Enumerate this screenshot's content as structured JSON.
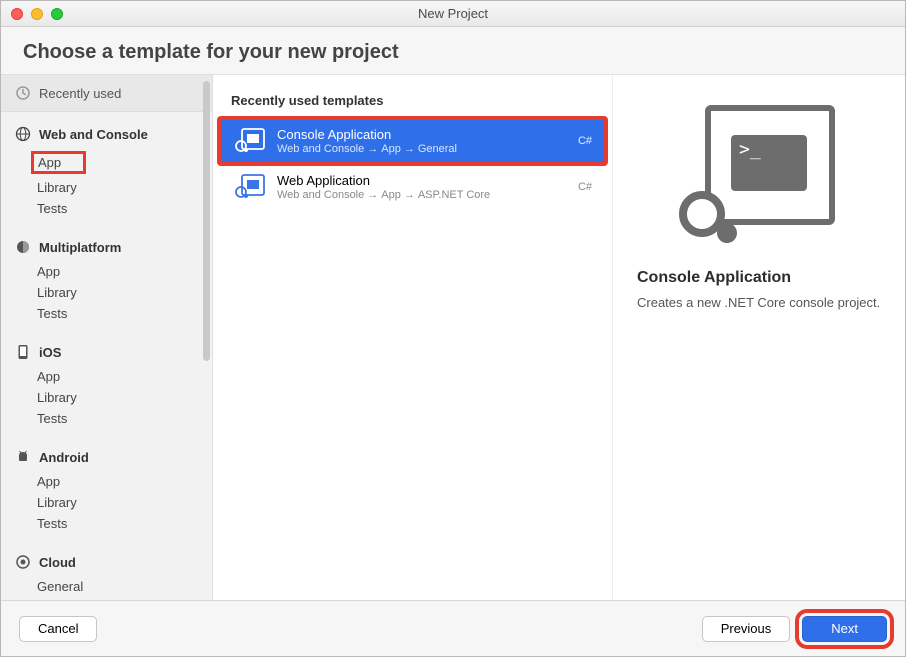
{
  "window": {
    "title": "New Project"
  },
  "header": {
    "title": "Choose a template for your new project"
  },
  "sidebar": {
    "recent_label": "Recently used",
    "categories": [
      {
        "label": "Web and Console",
        "items": [
          "App",
          "Library",
          "Tests"
        ],
        "icon": "globe"
      },
      {
        "label": "Multiplatform",
        "items": [
          "App",
          "Library",
          "Tests"
        ],
        "icon": "multiplatform"
      },
      {
        "label": "iOS",
        "items": [
          "App",
          "Library",
          "Tests"
        ],
        "icon": "ios"
      },
      {
        "label": "Android",
        "items": [
          "App",
          "Library",
          "Tests"
        ],
        "icon": "android"
      },
      {
        "label": "Cloud",
        "items": [
          "General"
        ],
        "icon": "cloud"
      }
    ]
  },
  "main": {
    "heading": "Recently used templates",
    "templates": [
      {
        "title": "Console Application",
        "path": [
          "Web and Console",
          "App",
          "General"
        ],
        "lang": "C#",
        "selected": true
      },
      {
        "title": "Web Application",
        "path": [
          "Web and Console",
          "App",
          "ASP.NET Core"
        ],
        "lang": "C#",
        "selected": false
      }
    ]
  },
  "detail": {
    "title": "Console Application",
    "description": "Creates a new .NET Core console project."
  },
  "footer": {
    "cancel": "Cancel",
    "previous": "Previous",
    "next": "Next"
  },
  "highlights": {
    "sidebar_app": true,
    "template_selected": true,
    "next_button": true
  }
}
